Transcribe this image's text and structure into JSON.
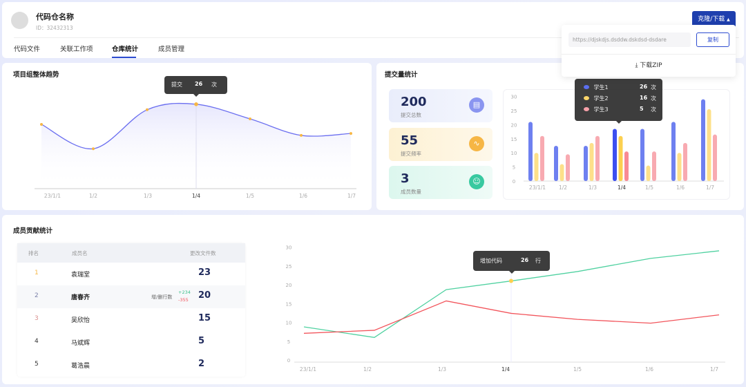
{
  "header": {
    "repo_name": "代码仓名称",
    "repo_id": "ID：32432313",
    "clone_button": "克隆/下载",
    "tabs": [
      {
        "label": "代码文件"
      },
      {
        "label": "关联工作项"
      },
      {
        "label": "仓库统计",
        "active": true
      },
      {
        "label": "成员管理"
      }
    ]
  },
  "clone_dropdown": {
    "url": "https://djskdjs.dsddw.dskdsd-dsdare",
    "copy_label": "复制",
    "download_label": "下载ZIP"
  },
  "trend": {
    "title": "项目组整体趋势",
    "tooltip": {
      "label": "提交",
      "value": "26",
      "unit": "次"
    }
  },
  "commits": {
    "title": "提交量统计",
    "stats": [
      {
        "value": "200",
        "label": "提交总数",
        "color": "#8a95f0"
      },
      {
        "value": "55",
        "label": "提交频率",
        "color": "#f6b645"
      },
      {
        "value": "3",
        "label": "成员数量",
        "color": "#38c9a0"
      }
    ],
    "tooltip": [
      {
        "name": "学生1",
        "value": "26",
        "unit": "次",
        "color": "#5b6ef0"
      },
      {
        "name": "学生2",
        "value": "16",
        "unit": "次",
        "color": "#fcd66a"
      },
      {
        "name": "学生3",
        "value": "5",
        "unit": "次",
        "color": "#f7a1aa"
      }
    ]
  },
  "members": {
    "title": "成员贡献统计",
    "columns": [
      "排名",
      "成员名",
      "更改文件数"
    ],
    "lines_label": "增/删行数",
    "rows": [
      {
        "rank": "1",
        "name": "袁瑞堂",
        "files": "23",
        "rank_color": "#f6b645"
      },
      {
        "rank": "2",
        "name": "唐春齐",
        "files": "20",
        "added": "+234",
        "deleted": "-355",
        "rank_color": "#7a80a8"
      },
      {
        "rank": "3",
        "name": "吴欣怡",
        "files": "15",
        "rank_color": "#d9908e"
      },
      {
        "rank": "4",
        "name": "马斌辉",
        "files": "5",
        "rank_color": "#333"
      },
      {
        "rank": "5",
        "name": "葛浩晨",
        "files": "2",
        "rank_color": "#333"
      }
    ],
    "tooltip": {
      "label": "增加代码",
      "value": "26",
      "unit": "行"
    }
  },
  "chart_data": [
    {
      "type": "area",
      "categories": [
        "23/1/1",
        "1/2",
        "1/3",
        "1/4",
        "1/5",
        "1/6",
        "1/7"
      ],
      "values": [
        19.8,
        12.3,
        24.3,
        26,
        21.5,
        16.4,
        17
      ],
      "highlight": "1/4",
      "color": "#6b6ff0"
    },
    {
      "type": "bar",
      "categories": [
        "23/1/1",
        "1/2",
        "1/3",
        "1/4",
        "1/5",
        "1/6",
        "1/7"
      ],
      "ylim": [
        0,
        30
      ],
      "yticks": [
        0,
        5,
        10,
        15,
        20,
        25,
        30
      ],
      "highlight": "1/4",
      "series": [
        {
          "name": "学生1",
          "values": [
            21,
            12.5,
            12.5,
            18.5,
            18.5,
            21,
            29
          ],
          "color": "#6e80f0"
        },
        {
          "name": "学生2",
          "values": [
            10,
            6,
            13.5,
            16,
            5.5,
            10,
            25.5
          ],
          "color": "#fde08a"
        },
        {
          "name": "学生3",
          "values": [
            16,
            9.5,
            16,
            10.5,
            10.5,
            13.5,
            16.5
          ],
          "color": "#f8aab1"
        }
      ]
    },
    {
      "type": "line",
      "categories": [
        "23/1/1",
        "1/2",
        "1/3",
        "1/4",
        "1/5",
        "1/6",
        "1/7"
      ],
      "ylim": [
        0,
        30
      ],
      "yticks": [
        0,
        5,
        10,
        15,
        20,
        25,
        30
      ],
      "highlight": "1/4",
      "series": [
        {
          "values": [
            8.8,
            6,
            18.7,
            21,
            23.5,
            27,
            29
          ],
          "color": "#4fd1a0"
        },
        {
          "values": [
            7.1,
            7.9,
            15.7,
            12.4,
            10.8,
            9.8,
            12
          ],
          "color": "#f2545b"
        }
      ]
    }
  ]
}
